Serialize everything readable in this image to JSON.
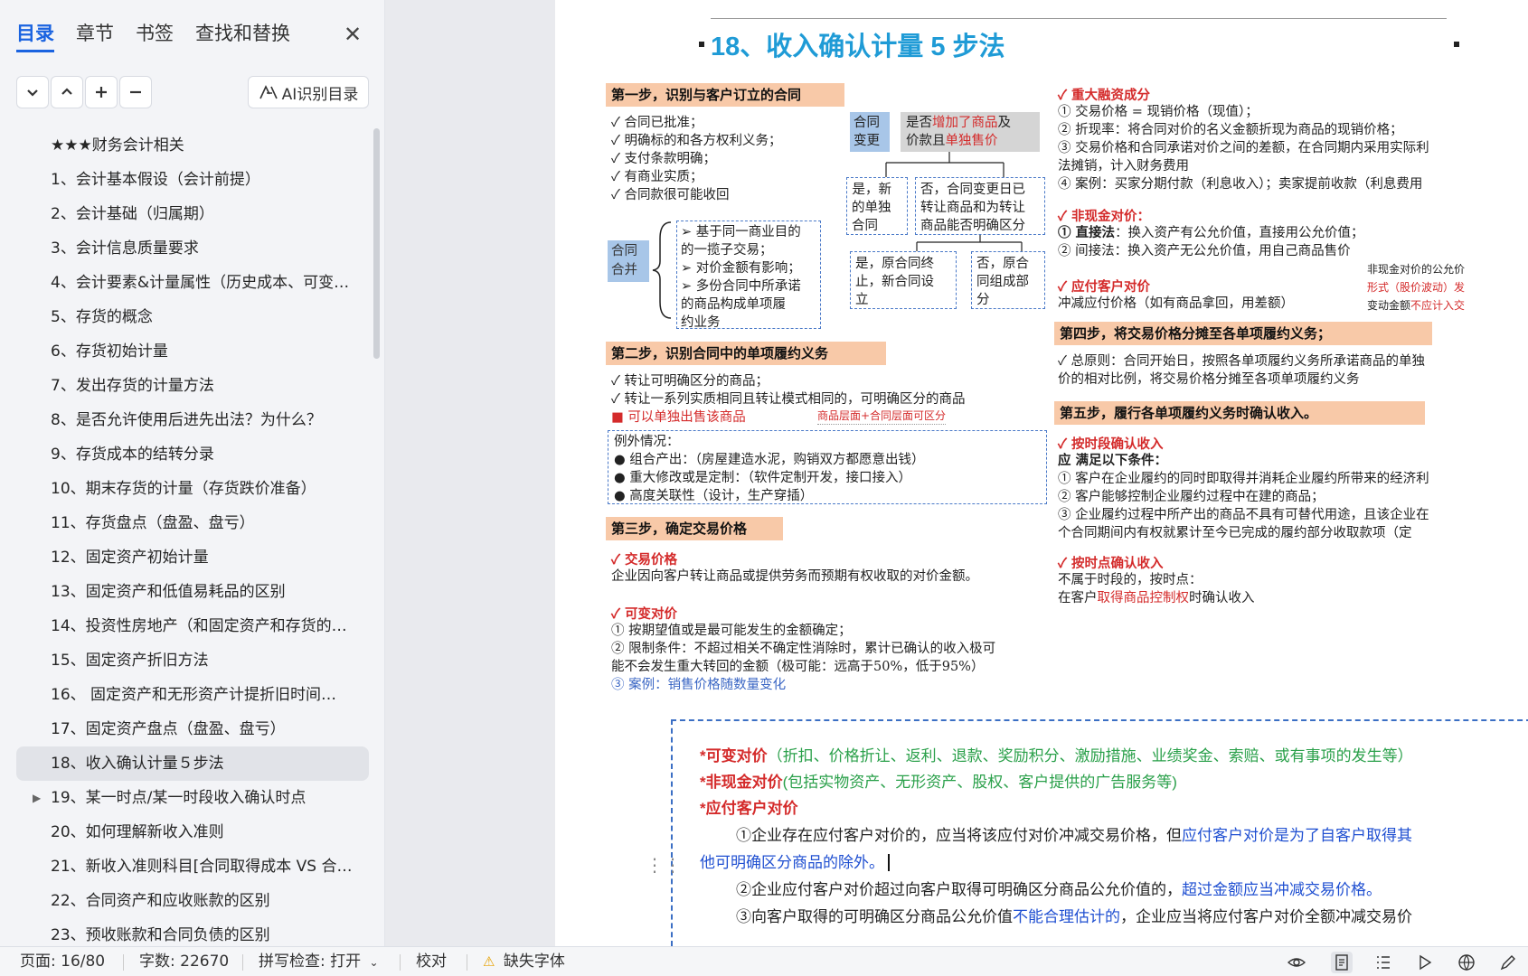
{
  "sidebar": {
    "tabs": [
      "目录",
      "章节",
      "书签",
      "查找和替换"
    ],
    "ai_button": "AI识别目录",
    "toc": [
      "★★★财务会计相关",
      "1、会计基本假设（会计前提）",
      "2、会计基础（归属期）",
      "3、会计信息质量要求",
      "4、会计要素&计量属性（历史成本、可变…",
      "5、存货的概念",
      "6、存货初始计量",
      "7、发出存货的计量方法",
      "8、是否允许使用后进先出法？为什么？",
      "9、存货成本的结转分录",
      "10、期末存货的计量（存货跌价准备）",
      "11、存货盘点（盘盈、盘亏）",
      "12、固定资产初始计量",
      "13、固定资产和低值易耗品的区别",
      "14、投资性房地产（和固定资产和存货的…",
      "15、固定资产折旧方法",
      "16、  固定资产和无形资产计提折旧时间…",
      "17、固定资产盘点（盘盈、盘亏）",
      "18、收入确认计量５步法",
      "19、某一时点/某一时段收入确认时点",
      "20、如何理解新收入准则",
      "21、新收入准则科目[合同取得成本 VS 合…",
      "22、合同资产和应收账款的区别",
      "23、预收账款和合同负债的区别"
    ]
  },
  "document": {
    "title": "18、收入确认计量 5 步法",
    "step1": {
      "head": "第一步，识别与客户订立的合同",
      "checks": [
        "✓ 合同已批准；",
        "✓ 明确标的和各方权利义务；",
        "✓ 支付条款明确；",
        "✓ 有商业实质；",
        "✓ 合同款很可能收回"
      ],
      "merge_label": [
        "合同",
        "合并"
      ],
      "merge_items": [
        "➢ 基于同一商业目的",
        "  的一揽子交易；",
        "➢ 对价金额有影响；",
        "➢ 多份合同中所承诺",
        "  的商品构成单项履",
        "  约业务"
      ],
      "change_label": [
        "合同",
        "变更"
      ],
      "change_q1": "是否",
      "change_q_red": "增加了商品",
      "change_q2": "及",
      "change_q3": "价款且",
      "change_q_red2": "单独售价",
      "yes_new": [
        "是，新",
        "的单独",
        "合同"
      ],
      "no_check": [
        "否，合同变更日已",
        "转让商品和为转让",
        "商品能否明确区分"
      ],
      "yes_end": [
        "是，原合同终",
        "止，新合同设",
        "立"
      ],
      "no_part": [
        "否，原合",
        "同组成部",
        "分"
      ]
    },
    "step2": {
      "head": "第二步，识别合同中的单项履约义务",
      "lines": [
        "✓ 转让可明确区分的商品；",
        "✓ 转让一系列实质相同且转让模式相同的，可明确区分的商品"
      ],
      "red_line": "可以单独出售该商品",
      "red_note": "商品层面+合同层面可区分",
      "exceptions_head": "例外情况：",
      "exceptions": [
        "● 组合产出：（房屋建造水泥，购销双方都愿意出钱）",
        "● 重大修改或是定制：（软件定制开发，接口接入）",
        "● 高度关联性（设计，生产穿插）"
      ]
    },
    "step3": {
      "head": "第三步，确定交易价格",
      "sub1": "✓ 交易价格",
      "sub1_text": "企业因向客户转让商品或提供劳务而预期有权收取的对价金额。",
      "sub2": "✓ 可变对价",
      "lines": [
        "① 按期望值或是最可能发生的金额确定；",
        "② 限制条件：不超过相关不确定性消除时，累计已确认的收入极可",
        "   能不会发生重大转回的金额（极可能：远高于50%，低于95%）"
      ],
      "case": "③ 案例：销售价格随数量变化"
    },
    "right": {
      "sub1": "✓ 重大融资成分",
      "sub1_lines": [
        "① 交易价格 = 现销价格（现值）；",
        "② 折现率：将合同对价的名义金额折现为商品的现销价格；",
        "③ 交易价格和合同承诺对价之间的差额，在合同期内采用实际利",
        "   法摊销，计入财务费用",
        "④ 案例：买家分期付款（利息收入）；卖家提前收款（利息费用"
      ],
      "sub2": "✓ 非现金对价：",
      "sub2_l1_b": "① 直接法",
      "sub2_l1": "：换入资产有公允价值，直接用公允价值；",
      "sub2_l2": "② 间接法：换入资产无公允价值，用自己商品售价",
      "sub3": "✓ 应付客户对价",
      "sub3_text": "冲减应付价格（如有商品拿回，用差额）",
      "side_note1": "非现金对价的公允价",
      "side_note2": "形式（股价波动）发",
      "side_note3a": "变动金额",
      "side_note3b": "不应计入交",
      "step4_head": "第四步，将交易价格分摊至各单项履约义务；",
      "step4_lines": [
        "✓ 总原则：合同开始日，按照各单项履约义务所承诺商品的单独",
        "   价的相对比例，将交易价格分摊至各项单项履约义务"
      ],
      "step5_head": "第五步，履行各单项履约义务时确认收入。",
      "s5_sub1": "✓ 按时段确认收入",
      "s5_cond": "应     满足以下条件：",
      "s5_lines": [
        "① 客户在企业履约的同时即取得并消耗企业履约所带来的经济利",
        "② 客户能够控制企业履约过程中在建的商品；",
        "③ 企业履约过程中所产出的商品不具有可替代用途，且该企业在",
        "   个合同期间内有权就累计至今已完成的履约部分收取款项（定"
      ],
      "s5_sub2": "✓ 按时点确认收入",
      "s5_p1": "不属于时段的，按时点：",
      "s5_p2a": "在客户",
      "s5_p2red": "取得商品控制权",
      "s5_p2b": "时确认收入"
    },
    "notes": {
      "n1_red": "*可变对价",
      "n1_green": "（折扣、价格折让、返利、退款、奖励积分、激励措施、业绩奖金、索赔、或有事项的发生等）",
      "n2_red": "*非现金对价",
      "n2_green": "(包括实物资产、无形资产、股权、客户提供的广告服务等)",
      "n3_red": "*应付客户对价",
      "p1a": "①企业存在应付客户对价的，应当将该应付对价冲减交易价格，但",
      "p1b": "应付客户对价是为了自客户取得其",
      "p1c": "他可明确区分商品的除外。",
      "p2a": "②企业应付客户对价超过向客户取得可明确区分商品公允价值的，",
      "p2b": "超过金额应当冲减交易价格。",
      "p3a": "③向客户取得的可明确区分商品公允价值",
      "p3b": "不能合理估计的",
      "p3c": "，企业应当将应付客户对价全额冲减交易价"
    }
  },
  "status": {
    "page": "页面: 16/80",
    "words": "字数: 22670",
    "spell": "拼写检查: 打开",
    "proof": "校对",
    "missing_font": "缺失字体"
  },
  "colors": {
    "accent": "#1a63e0",
    "title": "#1f9bd6",
    "step_head_bg": "#f8c9a8",
    "red": "#d42b2b",
    "green": "#2aa04a"
  }
}
